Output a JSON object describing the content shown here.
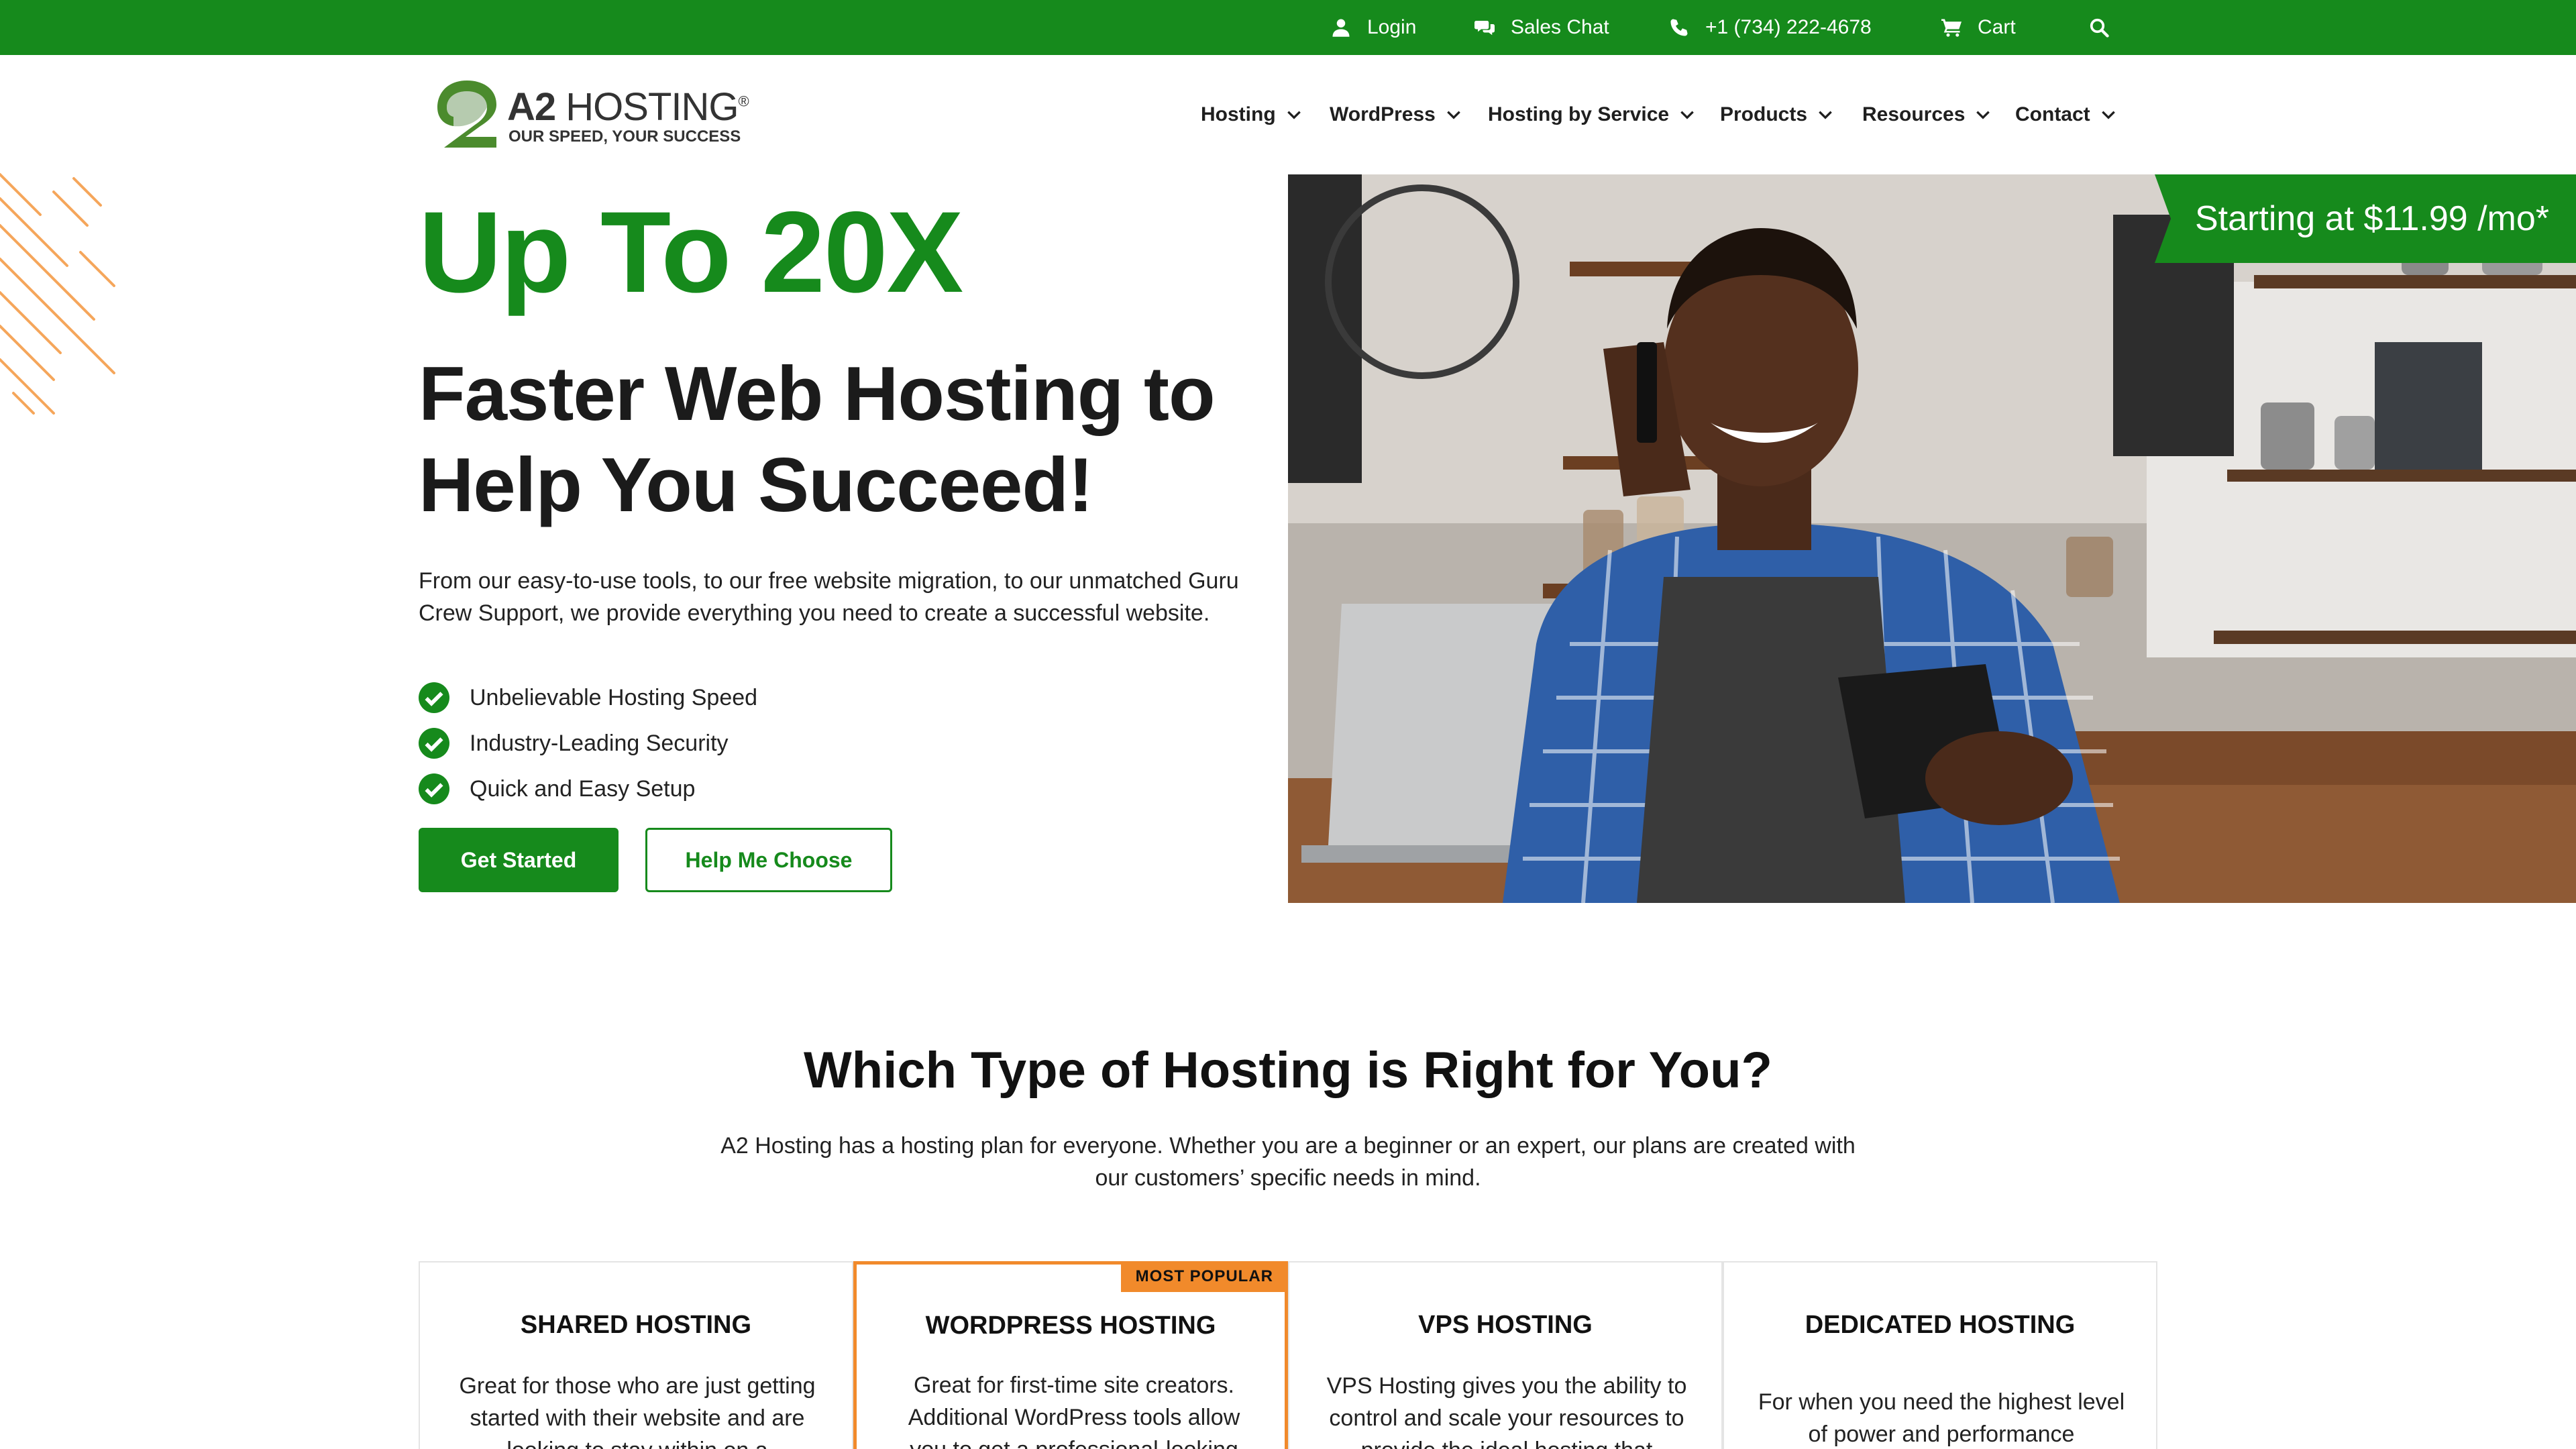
{
  "topbar": {
    "bg_color": "#168a1c",
    "items": [
      {
        "label": "Login",
        "icon": "user-icon"
      },
      {
        "label": "Sales Chat",
        "icon": "chat-icon"
      },
      {
        "label": "+1 (734) 222-4678",
        "icon": "phone-icon"
      },
      {
        "label": "Cart",
        "icon": "cart-icon"
      }
    ],
    "search_icon": "search-icon"
  },
  "logo": {
    "brand_bold": "A2",
    "brand_light": "HOSTING",
    "registered": "®",
    "tagline": "OUR SPEED, YOUR SUCCESS"
  },
  "nav": {
    "items": [
      {
        "label": "Hosting"
      },
      {
        "label": "WordPress"
      },
      {
        "label": "Hosting by Service"
      },
      {
        "label": "Products"
      },
      {
        "label": "Resources"
      },
      {
        "label": "Contact"
      }
    ]
  },
  "hero": {
    "headline": "Up To 20X",
    "subheadline": "Faster Web Hosting to Help You Succeed!",
    "description": "From our easy-to-use tools, to our free website migration, to our unmatched Guru Crew Support, we provide everything you need to create a successful website.",
    "features": [
      "Unbelievable Hosting Speed",
      "Industry-Leading Security",
      "Quick and Easy Setup"
    ],
    "primary_button": "Get Started",
    "secondary_button": "Help Me Choose",
    "price_tag": "Starting at $11.99 /mo*",
    "accent_color": "#168a1c"
  },
  "section": {
    "title": "Which Type of Hosting is Right for You?",
    "description": "A2 Hosting has a hosting plan for everyone. Whether you are a beginner or an expert, our plans are created with our customers’ specific needs in mind."
  },
  "cards": [
    {
      "title": "SHARED HOSTING",
      "description": "Great for those who are just getting started with their website and are looking to stay within on a"
    },
    {
      "title": "WORDPRESS HOSTING",
      "badge": "MOST POPULAR",
      "description": "Great for first-time site creators. Additional WordPress tools allow you to get a professional-looking"
    },
    {
      "title": "VPS HOSTING",
      "description": "VPS Hosting gives you the ability to control and scale your resources to provide the ideal hosting that"
    },
    {
      "title": "DEDICATED HOSTING",
      "description": "For when you need the highest level of power and performance"
    }
  ],
  "badge_color": "#f18a2b"
}
